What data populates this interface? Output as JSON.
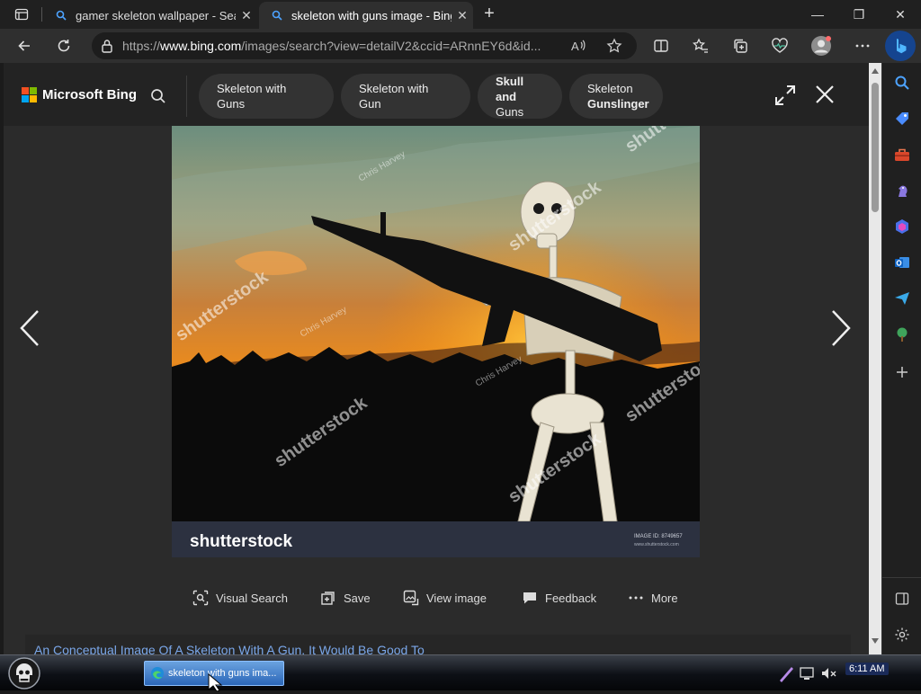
{
  "tabs": [
    {
      "title": "gamer skeleton wallpaper - Search",
      "close": "✕"
    },
    {
      "title": "skeleton with guns image - Bing",
      "close": "✕"
    }
  ],
  "new_tab": "+",
  "window_controls": {
    "minimize": "—",
    "restore": "❐",
    "close": "✕"
  },
  "address": {
    "url_prefix": "https://",
    "url_domain": "www.bing.com",
    "url_rest": "/images/search?view=detailV2&ccid=ARnnEY6d&id..."
  },
  "bing": {
    "logo_text": "Microsoft Bing",
    "logo_colors": [
      "#f25022",
      "#7fba00",
      "#00a4ef",
      "#ffb900"
    ],
    "chips": [
      {
        "line1": "Skeleton with Guns",
        "line2": "",
        "bold": ""
      },
      {
        "line1": "Skeleton with Gun",
        "line2": "",
        "bold": ""
      },
      {
        "line1": "",
        "line2": "Guns",
        "bold": "Skull and"
      },
      {
        "line1": "Skeleton",
        "line2": "",
        "bold": "Gunslinger"
      }
    ]
  },
  "image": {
    "watermark": "shutterstock",
    "author": "Chris Harvey",
    "image_id_label": "IMAGE ID: 8749657",
    "image_site": "www.shutterstock.com"
  },
  "actions": [
    {
      "label": "Visual Search",
      "icon": "visual-search-icon"
    },
    {
      "label": "Save",
      "icon": "save-icon"
    },
    {
      "label": "View image",
      "icon": "view-image-icon"
    },
    {
      "label": "Feedback",
      "icon": "feedback-icon"
    },
    {
      "label": "More",
      "icon": "more-icon"
    }
  ],
  "caption": "An Conceptual Image Of A Skeleton With A Gun, It Would Be Good To",
  "taskbar": {
    "app_label": "skeleton with guns ima...",
    "clock": "6:11 AM"
  },
  "colors": {
    "accent": "#0078d4",
    "page_bg": "#2b2b2b",
    "link": "#7aa7ea"
  }
}
